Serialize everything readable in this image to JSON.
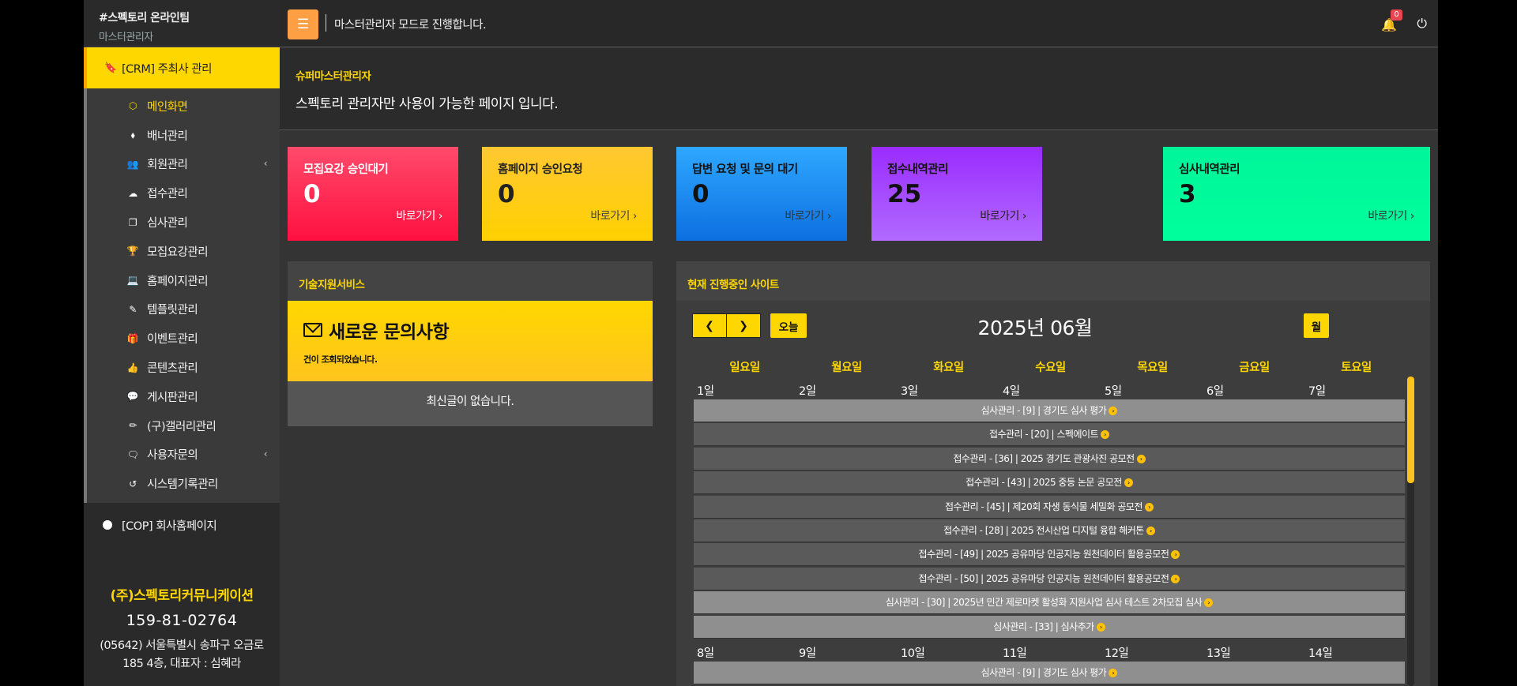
{
  "brand": {
    "title": "#스펙토리 온라인팀",
    "subtitle": "마스터관리자"
  },
  "sidebar": {
    "main_label": "[CRM] 주최사 관리",
    "items": [
      {
        "label": "메인화면",
        "icon": "box-icon",
        "glyph": "⬡"
      },
      {
        "label": "배너관리",
        "icon": "tag-icon",
        "glyph": "⬧"
      },
      {
        "label": "회원관리",
        "icon": "users-icon",
        "glyph": "👥",
        "chevron": "‹"
      },
      {
        "label": "접수관리",
        "icon": "cloud-upload-icon",
        "glyph": "☁"
      },
      {
        "label": "심사관리",
        "icon": "copy-icon",
        "glyph": "❐"
      },
      {
        "label": "모집요강관리",
        "icon": "trophy-icon",
        "glyph": "🏆"
      },
      {
        "label": "홈페이지관리",
        "icon": "laptop-icon",
        "glyph": "💻"
      },
      {
        "label": "템플릿관리",
        "icon": "magic-wand-icon",
        "glyph": "✎"
      },
      {
        "label": "이벤트관리",
        "icon": "gift-icon",
        "glyph": "🎁"
      },
      {
        "label": "콘텐츠관리",
        "icon": "thumbs-up-icon",
        "glyph": "👍"
      },
      {
        "label": "게시판관리",
        "icon": "comments-icon",
        "glyph": "💬"
      },
      {
        "label": "(구)갤러리관리",
        "icon": "pencil-icon",
        "glyph": "✏"
      },
      {
        "label": "사용자문의",
        "icon": "comment-icon",
        "glyph": "🗨",
        "chevron": "‹"
      },
      {
        "label": "시스템기록관리",
        "icon": "history-icon",
        "glyph": "↺"
      }
    ],
    "cop_label": "[COP] 회사홈페이지"
  },
  "company": {
    "name": "(주)스펙토리커뮤니케이션",
    "phone": "159-81-02764",
    "address": "(05642) 서울특별시 송파구 오금로 185 4층, 대표자 : 심혜라"
  },
  "topbar": {
    "message": "마스터관리자 모드로 진행합니다.",
    "notification_count": "0"
  },
  "header": {
    "subtitle": "슈퍼마스터관리자",
    "description": "스펙토리 관리자만 사용이 가능한 페이지 입니다."
  },
  "stats": [
    {
      "label": "모집요강 승인대기",
      "value": "0",
      "link": "바로가기"
    },
    {
      "label": "홈페이지 승인요청",
      "value": "0",
      "link": "바로가기"
    },
    {
      "label": "답변 요청 및 문의 대기",
      "value": "0",
      "link": "바로가기"
    },
    {
      "label": "접수내역관리",
      "value": "25",
      "link": "바로가기"
    },
    {
      "label": "심사내역관리",
      "value": "3",
      "link": "바로가기"
    }
  ],
  "tech_support": {
    "title": "기술지원서비스",
    "box_title": "새로운 문의사항",
    "box_sub": "건이 조회되었습니다.",
    "empty": "최신글이 없습니다."
  },
  "calendar": {
    "panel_title": "현재 진행중인 사이트",
    "today_label": "오늘",
    "month_label": "월",
    "title": "2025년 06월",
    "weekdays": [
      "일요일",
      "월요일",
      "화요일",
      "수요일",
      "목요일",
      "금요일",
      "토요일"
    ],
    "week1_days": [
      "1일",
      "2일",
      "3일",
      "4일",
      "5일",
      "6일",
      "7일"
    ],
    "week2_days": [
      "8일",
      "9일",
      "10일",
      "11일",
      "12일",
      "13일",
      "14일"
    ],
    "week1_events": [
      "심사관리 - [9] | 경기도 심사 평가",
      "접수관리 - [20] | 스펙에이트",
      "접수관리 - [36] | 2025 경기도 관광사진 공모전",
      "접수관리 - [43] | 2025 중등 논문 공모전",
      "접수관리 - [45] | 제20회 자생 동식물 세밀화 공모전",
      "접수관리 - [28] | 2025 전시산업 디지털 융합 해커톤",
      "접수관리 - [49] | 2025 공유마당 인공지능 원천데이터 활용공모전",
      "접수관리 - [50] | 2025 공유마당 인공지능 원천데이터 활용공모전",
      "심사관리 - [30] | 2025년 민간 제로마켓 활성화 지원사업 심사 테스트 2차모집 심사",
      "심사관리 - [33] | 심사추가"
    ],
    "week2_events": [
      "심사관리 - [9] | 경기도 심사 평가"
    ]
  },
  "colors": {
    "accent": "#ffd700",
    "sidebar_bg": "#2a2a2a",
    "content_bg": "#343434",
    "hamburger": "#ff9f43"
  }
}
